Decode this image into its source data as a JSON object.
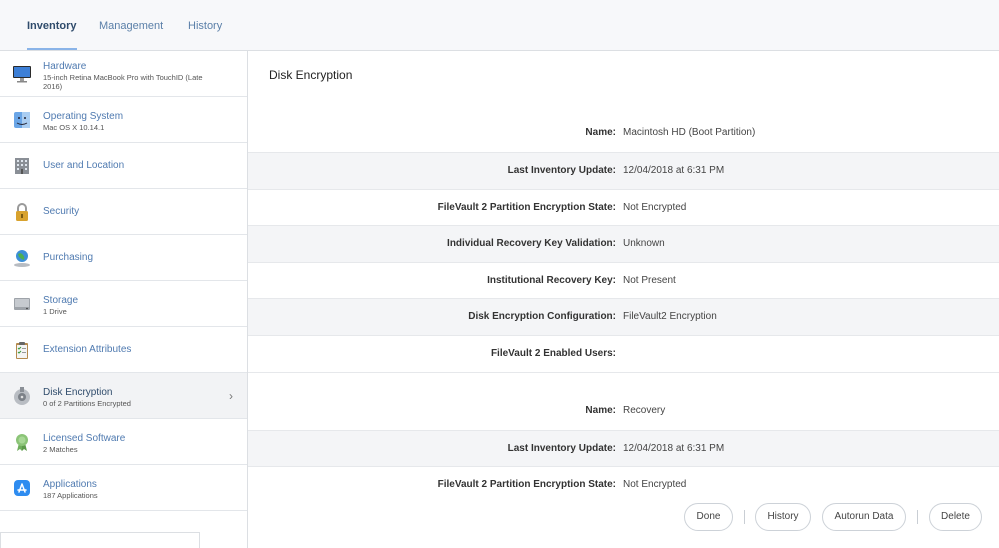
{
  "tabs": [
    {
      "label": "Inventory",
      "active": true
    },
    {
      "label": "Management",
      "active": false
    },
    {
      "label": "History",
      "active": false
    }
  ],
  "sidebar": {
    "items": [
      {
        "title": "Hardware",
        "subtitle": "15-inch Retina MacBook Pro with TouchID (Late 2016)",
        "icon": "monitor-icon"
      },
      {
        "title": "Operating System",
        "subtitle": "Mac OS X 10.14.1",
        "icon": "finder-icon"
      },
      {
        "title": "User and Location",
        "subtitle": "",
        "icon": "building-icon"
      },
      {
        "title": "Security",
        "subtitle": "",
        "icon": "padlock-icon"
      },
      {
        "title": "Purchasing",
        "subtitle": "",
        "icon": "globe-icon"
      },
      {
        "title": "Storage",
        "subtitle": "1 Drive",
        "icon": "hard-drive-icon"
      },
      {
        "title": "Extension Attributes",
        "subtitle": "",
        "icon": "clipboard-icon"
      },
      {
        "title": "Disk Encryption",
        "subtitle": "0 of 2 Partitions Encrypted",
        "icon": "disk-utility-icon",
        "selected": true
      },
      {
        "title": "Licensed Software",
        "subtitle": "2 Matches",
        "icon": "award-ribbon-icon"
      },
      {
        "title": "Applications",
        "subtitle": "187 Applications",
        "icon": "app-store-icon"
      }
    ],
    "chevron": "›"
  },
  "main": {
    "title": "Disk Encryption",
    "partitions": [
      {
        "rows": [
          {
            "label": "Name:",
            "value": "Macintosh HD (Boot Partition)"
          },
          {
            "label": "Last Inventory Update:",
            "value": "12/04/2018 at 6:31 PM"
          },
          {
            "label": "FileVault 2 Partition Encryption State:",
            "value": "Not Encrypted"
          },
          {
            "label": "Individual Recovery Key Validation:",
            "value": "Unknown"
          },
          {
            "label": "Institutional Recovery Key:",
            "value": "Not Present"
          },
          {
            "label": "Disk Encryption Configuration:",
            "value": "FileVault2 Encryption"
          },
          {
            "label": "FileVault 2 Enabled Users:",
            "value": ""
          }
        ]
      },
      {
        "rows": [
          {
            "label": "Name:",
            "value": "Recovery"
          },
          {
            "label": "Last Inventory Update:",
            "value": "12/04/2018 at 6:31 PM"
          },
          {
            "label": "FileVault 2 Partition Encryption State:",
            "value": "Not Encrypted"
          }
        ]
      }
    ]
  },
  "footer": {
    "done": "Done",
    "history": "History",
    "autorun": "Autorun Data",
    "delete": "Delete"
  },
  "colors": {
    "accent": "#4f7ab0",
    "tab_underline": "#8ab4e8",
    "row_shade": "#f4f5f7"
  }
}
